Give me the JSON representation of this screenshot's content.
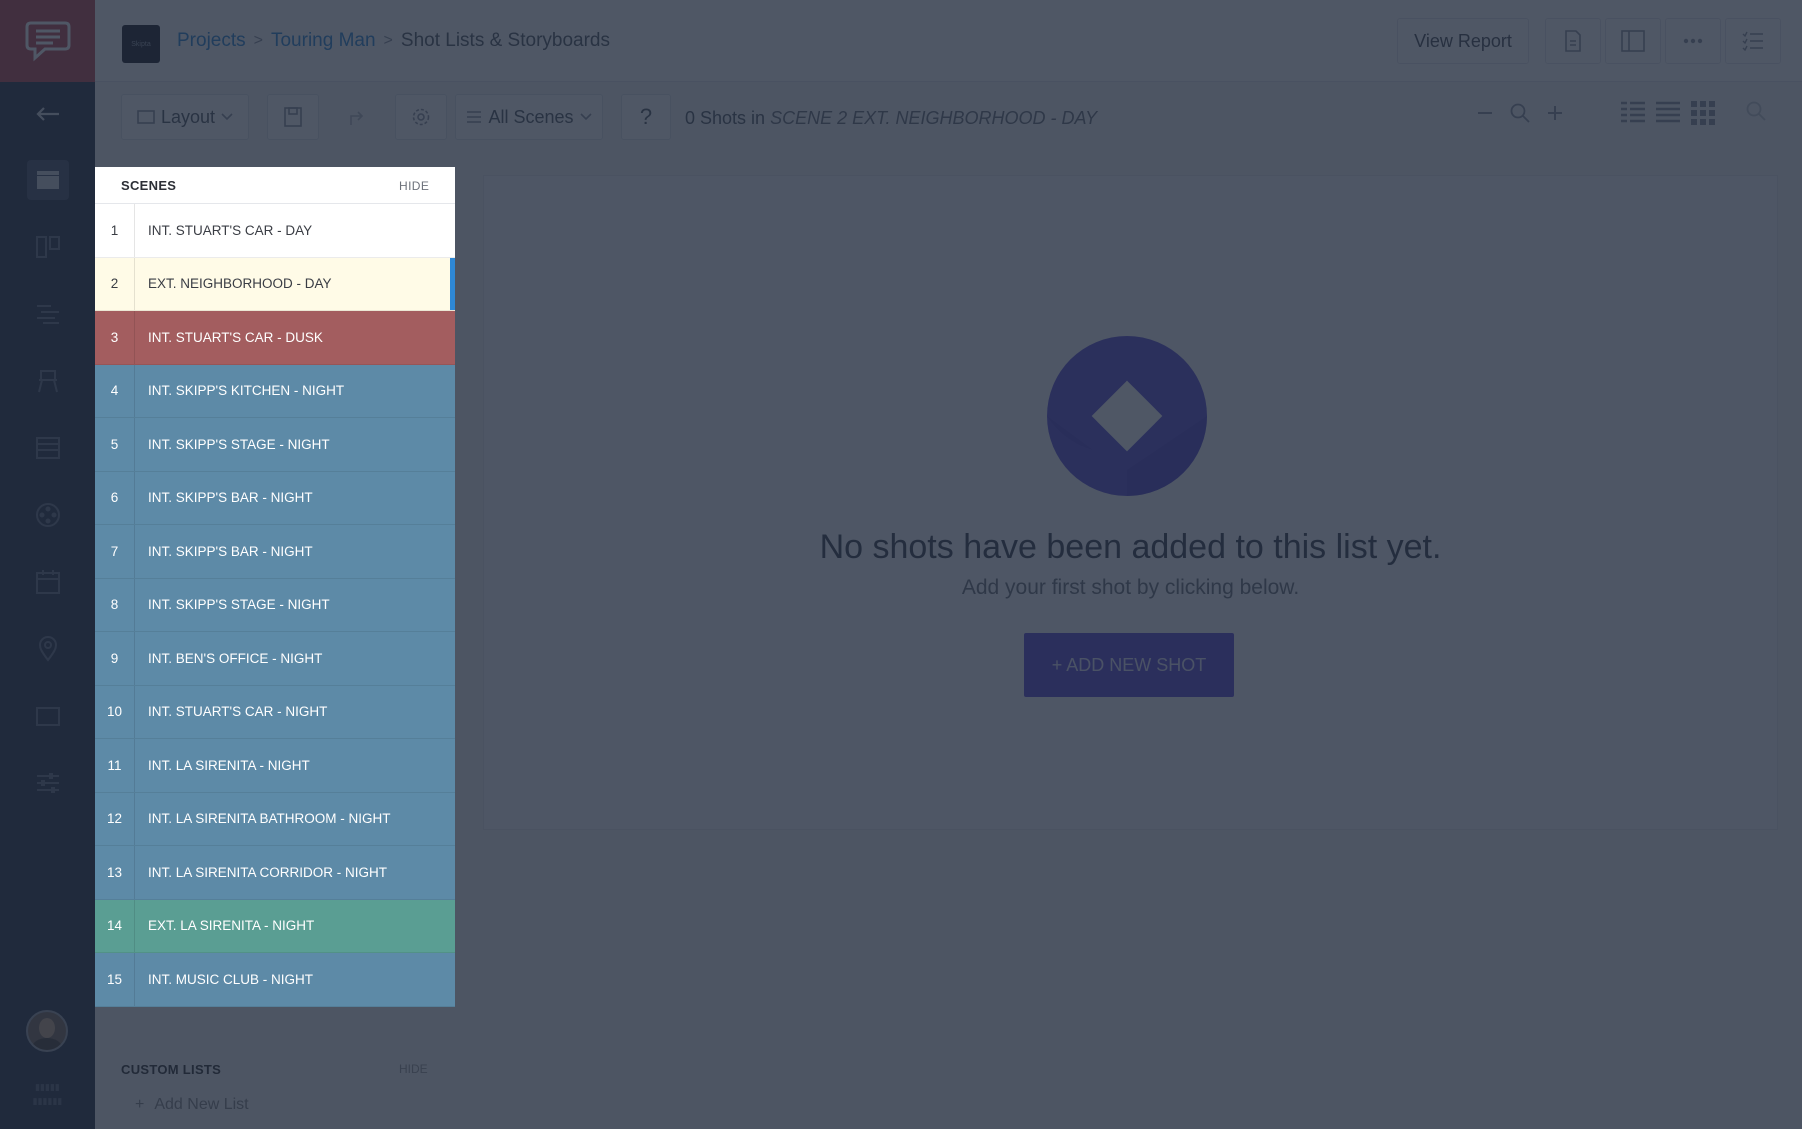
{
  "header": {
    "project_thumb_text": "Skipta",
    "breadcrumb": [
      "Projects",
      "Touring Man",
      "Shot Lists & Storyboards"
    ],
    "view_report_label": "View Report"
  },
  "toolbar": {
    "layout_label": "Layout",
    "scenes_filter_label": "All Scenes",
    "help_label": "?",
    "shots_prefix": "0 Shots in",
    "shots_scene": "SCENE 2 EXT. NEIGHBORHOOD - DAY"
  },
  "empty_state": {
    "title": "No shots have been added to this list yet.",
    "subtitle": "Add your first shot by clicking below.",
    "button_label": "+ ADD NEW SHOT"
  },
  "scenes_panel": {
    "title": "SCENES",
    "hide_label": "HIDE",
    "selected_index": 1,
    "items": [
      {
        "num": "1",
        "label": "INT. STUART'S CAR - DAY",
        "color": "#ffffff"
      },
      {
        "num": "2",
        "label": "EXT. NEIGHBORHOOD - DAY",
        "color": "#fffbe7"
      },
      {
        "num": "3",
        "label": "INT. STUART'S CAR - DUSK",
        "color": "#a35d5f"
      },
      {
        "num": "4",
        "label": "INT. SKIPP'S KITCHEN - NIGHT",
        "color": "#5d8aa7"
      },
      {
        "num": "5",
        "label": "INT. SKIPP'S STAGE - NIGHT",
        "color": "#5d8aa7"
      },
      {
        "num": "6",
        "label": "INT. SKIPP'S BAR - NIGHT",
        "color": "#5d8aa7"
      },
      {
        "num": "7",
        "label": "INT. SKIPP'S BAR - NIGHT",
        "color": "#5d8aa7"
      },
      {
        "num": "8",
        "label": "INT. SKIPP'S STAGE - NIGHT",
        "color": "#5d8aa7"
      },
      {
        "num": "9",
        "label": "INT. BEN'S OFFICE - NIGHT",
        "color": "#5d8aa7"
      },
      {
        "num": "10",
        "label": "INT. STUART'S CAR - NIGHT",
        "color": "#5d8aa7"
      },
      {
        "num": "11",
        "label": "INT. LA SIRENITA - NIGHT",
        "color": "#5d8aa7"
      },
      {
        "num": "12",
        "label": "INT. LA SIRENITA BATHROOM - NIGHT",
        "color": "#5d8aa7"
      },
      {
        "num": "13",
        "label": "INT. LA SIRENITA CORRIDOR - NIGHT",
        "color": "#5d8aa7"
      },
      {
        "num": "14",
        "label": "EXT. LA SIRENITA - NIGHT",
        "color": "#5a9e93"
      },
      {
        "num": "15",
        "label": "INT. MUSIC CLUB - NIGHT",
        "color": "#5d8aa7"
      }
    ]
  },
  "custom_lists": {
    "title": "CUSTOM LISTS",
    "hide_label": "HIDE",
    "add_label": "Add New List"
  },
  "colors": {
    "accent": "#2e88d6",
    "brand": "#c04854",
    "rail": "#2b3447",
    "primary_button": "#5b48d6"
  }
}
